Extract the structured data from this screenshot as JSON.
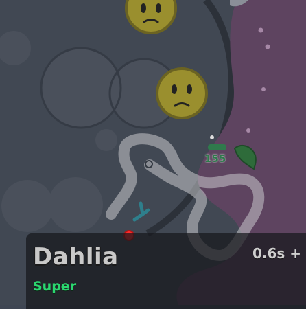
{
  "hud": {
    "flower_name": "Dahlia",
    "rarity": "Super",
    "rarity_color": "#2bd66f",
    "cooldown": "0.6s +"
  },
  "world": {
    "mob_health_label": "155",
    "player_color": "#ff3b3b",
    "mob_color": "#9a8f2e",
    "terrain_color": "#5e4460",
    "petal_color": "#2e7f8c",
    "mobs": [
      {
        "type": "sad-face",
        "icon": "frown-face-icon"
      },
      {
        "type": "sad-face",
        "icon": "frown-face-icon"
      }
    ]
  }
}
